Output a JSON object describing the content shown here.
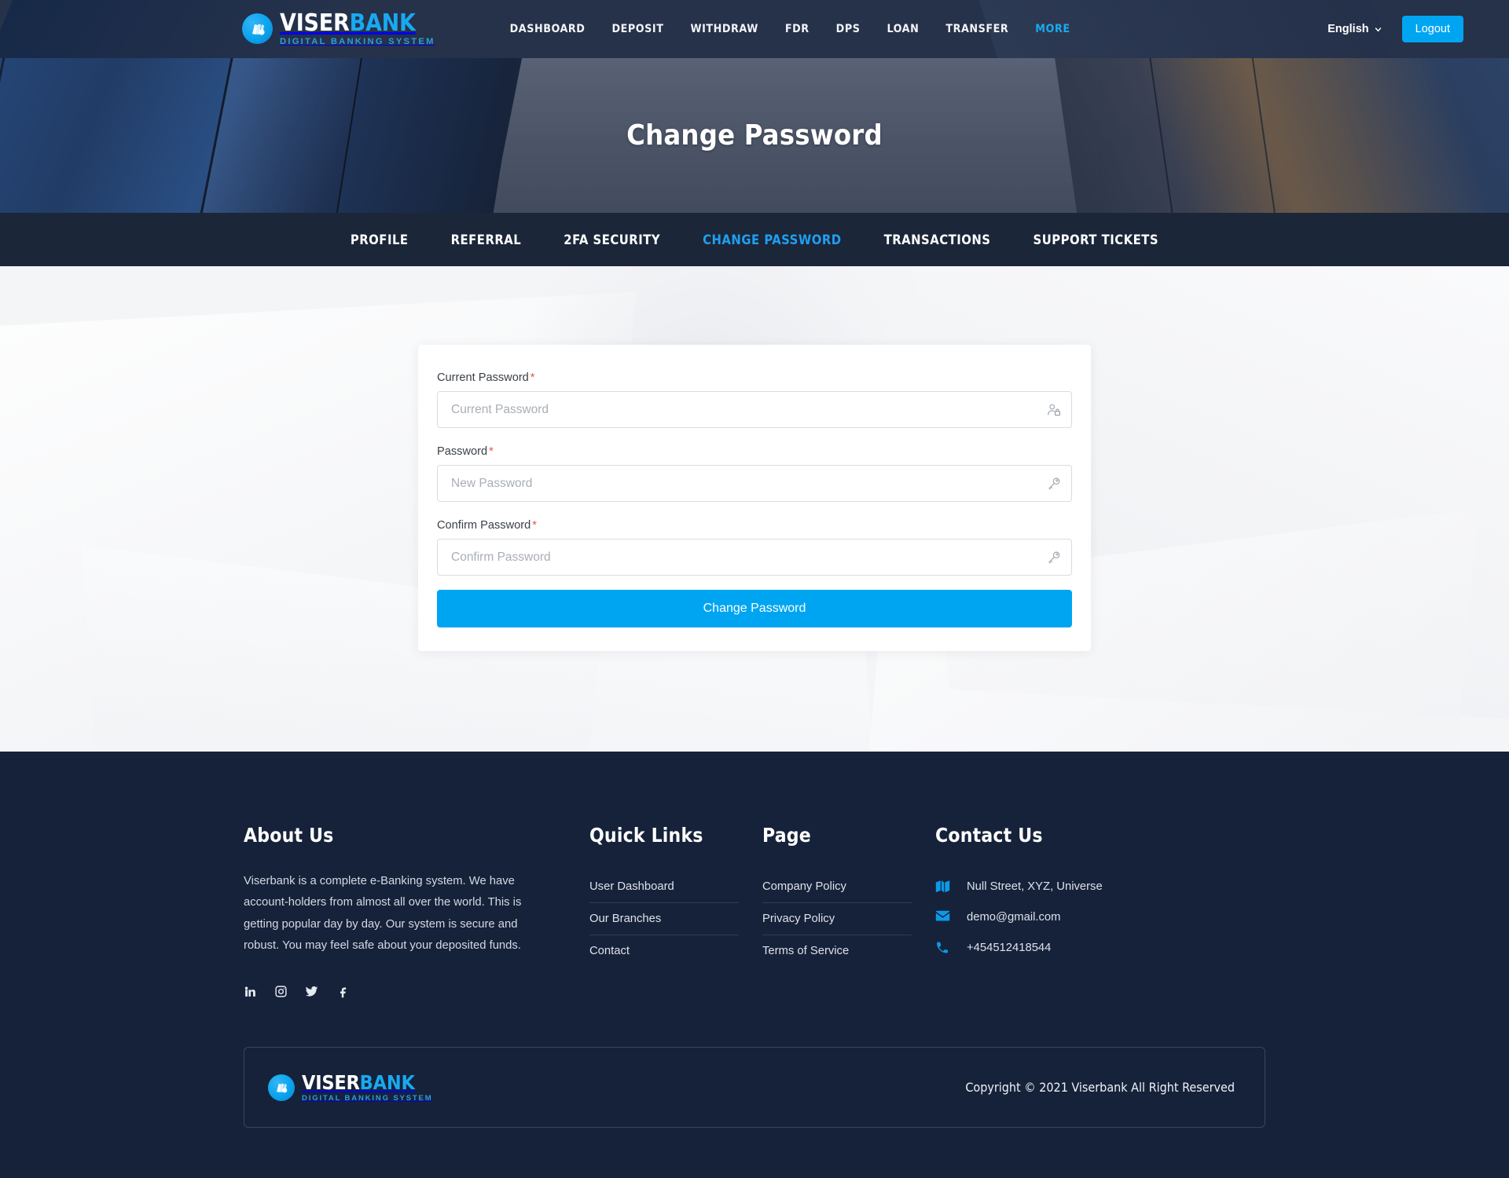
{
  "brand": {
    "name_part1": "VISER",
    "name_part2": "BANK",
    "tagline": "DIGITAL BANKING SYSTEM",
    "accent_color": "#00a5f2",
    "header_bg": "#243047",
    "footer_bg": "#16223a",
    "tabbar_bg": "#1b2639"
  },
  "header": {
    "nav": [
      {
        "label": "DASHBOARD",
        "active": false
      },
      {
        "label": "DEPOSIT",
        "active": false
      },
      {
        "label": "WITHDRAW",
        "active": false
      },
      {
        "label": "FDR",
        "active": false
      },
      {
        "label": "DPS",
        "active": false
      },
      {
        "label": "LOAN",
        "active": false
      },
      {
        "label": "TRANSFER",
        "active": false
      },
      {
        "label": "MORE",
        "active": true
      }
    ],
    "language": "English",
    "logout_label": "Logout"
  },
  "hero": {
    "title": "Change Password"
  },
  "tabs": [
    {
      "label": "PROFILE",
      "active": false
    },
    {
      "label": "REFERRAL",
      "active": false
    },
    {
      "label": "2FA SECURITY",
      "active": false
    },
    {
      "label": "CHANGE PASSWORD",
      "active": true
    },
    {
      "label": "TRANSACTIONS",
      "active": false
    },
    {
      "label": "SUPPORT TICKETS",
      "active": false
    }
  ],
  "form": {
    "fields": [
      {
        "label": "Current Password",
        "required_mark": "*",
        "placeholder": "Current Password",
        "value": "",
        "icon": "user-lock-icon"
      },
      {
        "label": "Password",
        "required_mark": "*",
        "placeholder": "New Password",
        "value": "",
        "icon": "key-icon"
      },
      {
        "label": "Confirm Password",
        "required_mark": "*",
        "placeholder": "Confirm Password",
        "value": "",
        "icon": "key-icon"
      }
    ],
    "submit_label": "Change Password"
  },
  "footer": {
    "about": {
      "title": "About Us",
      "text": "Viserbank is a complete e-Banking system. We have account-holders from almost all over the world. This is getting popular day by day. Our system is secure and robust. You may feel safe about your deposited funds."
    },
    "socials": [
      {
        "name": "linkedin-icon"
      },
      {
        "name": "instagram-icon"
      },
      {
        "name": "twitter-icon"
      },
      {
        "name": "facebook-icon"
      }
    ],
    "quick_links": {
      "title": "Quick Links",
      "items": [
        "User Dashboard",
        "Our Branches",
        "Contact"
      ]
    },
    "page_links": {
      "title": "Page",
      "items": [
        "Company Policy",
        "Privacy Policy",
        "Terms of Service"
      ]
    },
    "contact": {
      "title": "Contact Us",
      "items": [
        {
          "icon": "map-icon",
          "text": "Null Street, XYZ, Universe"
        },
        {
          "icon": "envelope-icon",
          "text": "demo@gmail.com"
        },
        {
          "icon": "phone-icon",
          "text": "+454512418544"
        }
      ]
    },
    "copyright": "Copyright © 2021 Viserbank All Right Reserved"
  }
}
